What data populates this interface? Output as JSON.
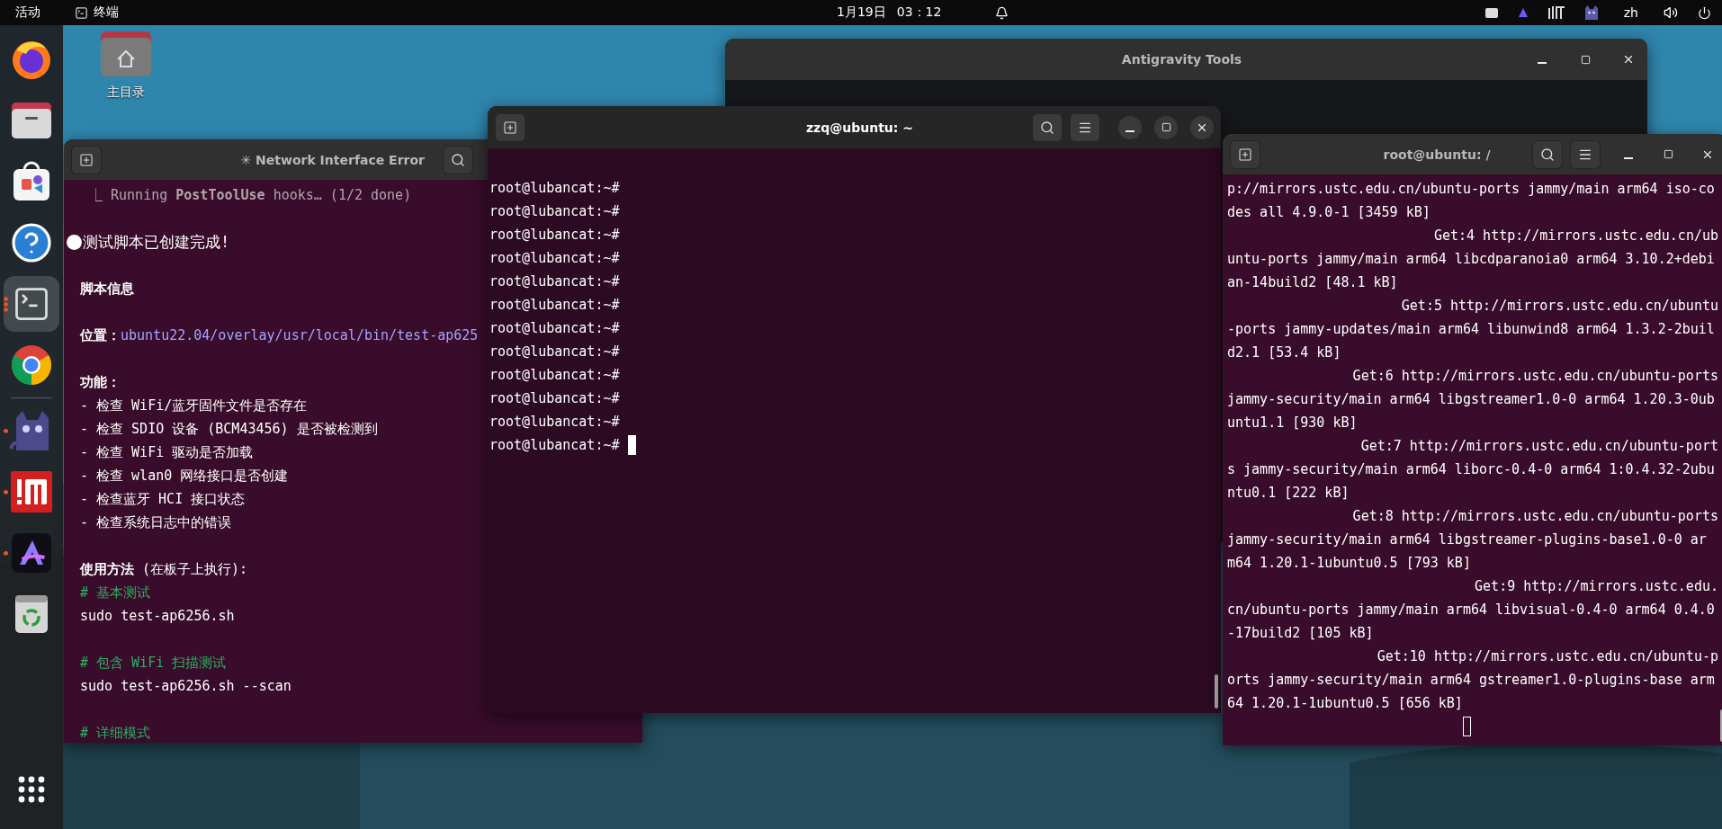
{
  "top_bar": {
    "activities": "活动",
    "app": "终端",
    "date": "1月19日",
    "time": "03：12",
    "language": "zh"
  },
  "dock": {
    "items": [
      {
        "kind": "firefox",
        "running": false,
        "active": false
      },
      {
        "kind": "files",
        "running": false,
        "active": false
      },
      {
        "kind": "store",
        "running": false,
        "active": false
      },
      {
        "kind": "help",
        "running": false,
        "active": false
      },
      {
        "kind": "terminal",
        "running": true,
        "active": true
      },
      {
        "kind": "chrome",
        "running": false,
        "active": false
      },
      {
        "kind": "separator"
      },
      {
        "kind": "cat",
        "running": true,
        "active": false
      },
      {
        "kind": "red",
        "running": true,
        "active": false
      },
      {
        "kind": "arrow",
        "running": true,
        "active": false
      },
      {
        "kind": "trash",
        "running": false,
        "active": false
      }
    ]
  },
  "desktop_icons": [
    {
      "label": "主目录"
    }
  ],
  "background_window": {
    "title": "Antigravity Tools"
  },
  "left_terminal": {
    "title": "✳ Network Interface Error",
    "focused": false,
    "lines": [
      {
        "kind": "status",
        "text": "⎿ Running **PostToolUse** hooks… (1/2 done)"
      },
      {
        "kind": "blank"
      },
      {
        "kind": "bullet",
        "text": "测试脚本已创建完成!"
      },
      {
        "kind": "blank"
      },
      {
        "kind": "heading",
        "text": "脚本信息"
      },
      {
        "kind": "blank"
      },
      {
        "kind": "field",
        "label": "位置：",
        "value": "ubuntu22.04/overlay/usr/local/bin/test-ap625"
      },
      {
        "kind": "blank"
      },
      {
        "kind": "heading",
        "text": "功能："
      },
      {
        "kind": "text",
        "text": "- 检查 WiFi/蓝牙固件文件是否存在"
      },
      {
        "kind": "text",
        "text": "- 检查 SDIO 设备 (BCM43456) 是否被检测到"
      },
      {
        "kind": "text",
        "text": "- 检查 WiFi 驱动是否加载"
      },
      {
        "kind": "text",
        "text": "- 检查 wlan0 网络接口是否创建"
      },
      {
        "kind": "text",
        "text": "- 检查蓝牙 HCI 接口状态"
      },
      {
        "kind": "text",
        "text": "- 检查系统日志中的错误"
      },
      {
        "kind": "blank"
      },
      {
        "kind": "text",
        "text": "**使用方法** (在板子上执行):"
      },
      {
        "kind": "comment",
        "text": "# 基本测试"
      },
      {
        "kind": "text",
        "text": "sudo test-ap6256.sh"
      },
      {
        "kind": "blank"
      },
      {
        "kind": "comment",
        "text": "# 包含 WiFi 扫描测试"
      },
      {
        "kind": "text",
        "text": "sudo test-ap6256.sh --scan"
      },
      {
        "kind": "blank"
      },
      {
        "kind": "comment",
        "text": "# 详细模式"
      }
    ]
  },
  "middle_terminal": {
    "title": "zzq@ubuntu: ~",
    "focused": true,
    "lines": [
      "root@lubancat:~#",
      "root@lubancat:~#",
      "root@lubancat:~#",
      "root@lubancat:~#",
      "root@lubancat:~#",
      "root@lubancat:~#",
      "root@lubancat:~#",
      "root@lubancat:~#",
      "root@lubancat:~#",
      "root@lubancat:~#",
      "root@lubancat:~#",
      "root@lubancat:~#"
    ]
  },
  "right_terminal": {
    "title": "root@ubuntu: /",
    "focused": false,
    "lines": [
      {
        "kind": "wrap",
        "text": "p://mirrors.ustc.edu.cn/ubuntu-ports jammy/main arm64 iso-co"
      },
      {
        "kind": "wrap",
        "text": "des all 4.9.0-1 [3459 kB]"
      },
      {
        "kind": "get",
        "text": "Get:4 http://mirrors.ustc.edu.cn/ub"
      },
      {
        "kind": "wrap",
        "text": "untu-ports jammy/main arm64 libcdparanoia0 arm64 3.10.2+debi"
      },
      {
        "kind": "wrap",
        "text": "an-14build2 [48.1 kB]"
      },
      {
        "kind": "get",
        "text": "Get:5 http://mirrors.ustc.edu.cn/ubuntu"
      },
      {
        "kind": "wrap",
        "text": "-ports jammy-updates/main arm64 libunwind8 arm64 1.3.2-2buil"
      },
      {
        "kind": "wrap",
        "text": "d2.1 [53.4 kB]"
      },
      {
        "kind": "get",
        "text": "Get:6 http://mirrors.ustc.edu.cn/ubuntu-ports"
      },
      {
        "kind": "wrap",
        "text": "jammy-security/main arm64 libgstreamer1.0-0 arm64 1.20.3-0ub"
      },
      {
        "kind": "wrap",
        "text": "untu1.1 [930 kB]"
      },
      {
        "kind": "get",
        "text": "Get:7 http://mirrors.ustc.edu.cn/ubuntu-port"
      },
      {
        "kind": "wrap",
        "text": "s jammy-security/main arm64 liborc-0.4-0 arm64 1:0.4.32-2ubu"
      },
      {
        "kind": "wrap",
        "text": "ntu0.1 [222 kB]"
      },
      {
        "kind": "get",
        "text": "Get:8 http://mirrors.ustc.edu.cn/ubuntu-ports"
      },
      {
        "kind": "wrap",
        "text": "jammy-security/main arm64 libgstreamer-plugins-base1.0-0 ar"
      },
      {
        "kind": "wrap",
        "text": "m64 1.20.1-1ubuntu0.5 [793 kB]"
      },
      {
        "kind": "get",
        "text": "Get:9 http://mirrors.ustc.edu."
      },
      {
        "kind": "wrap",
        "text": "cn/ubuntu-ports jammy/main arm64 libvisual-0.4-0 arm64 0.4.0"
      },
      {
        "kind": "wrap",
        "text": "-17build2 [105 kB]"
      },
      {
        "kind": "get",
        "text": "Get:10 http://mirrors.ustc.edu.cn/ubuntu-p"
      },
      {
        "kind": "wrap",
        "text": "orts jammy-security/main arm64 gstreamer1.0-plugins-base arm"
      },
      {
        "kind": "wrap",
        "text": "64 1.20.1-1ubuntu0.5 [656 kB]"
      }
    ]
  }
}
